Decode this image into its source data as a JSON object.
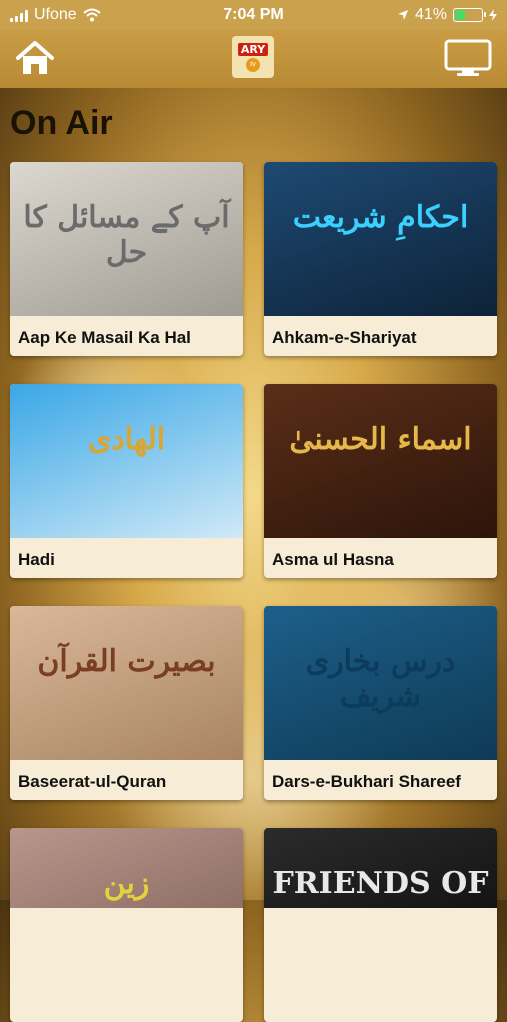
{
  "status_bar": {
    "carrier": "Ufone",
    "time": "7:04 PM",
    "battery_percent": "41%",
    "battery_level": 0.41,
    "icons": [
      "signal-icon",
      "wifi-icon",
      "location-arrow-icon",
      "battery-icon",
      "charging-icon"
    ]
  },
  "nav": {
    "home_icon": "home-icon",
    "logo_text": "ARY",
    "logo_sub": "tv",
    "tv_icon": "tv-monitor-icon"
  },
  "section_title": "On Air",
  "programs": [
    {
      "label": "Aap Ke Masail Ka Hal",
      "thumb_text": "آپ کے مسائل کا حل",
      "bg1": "#dcd8cf",
      "bg2": "#9f9b93",
      "text_color": "#6b6b6b"
    },
    {
      "label": "Ahkam-e-Shariyat",
      "thumb_text": "احکامِ شریعت",
      "bg1": "#1e4a73",
      "bg2": "#0d2238",
      "text_color": "#3ad0ff"
    },
    {
      "label": "Hadi",
      "thumb_text": "الهادی",
      "bg1": "#3aa7e6",
      "bg2": "#cfe9f7",
      "text_color": "#d9a62e"
    },
    {
      "label": "Asma ul Hasna",
      "thumb_text": "اسماء الحسنیٰ",
      "bg1": "#5a2e18",
      "bg2": "#2d140a",
      "text_color": "#e6b84a"
    },
    {
      "label": "Baseerat-ul-Quran",
      "thumb_text": "بصیرت القرآن",
      "bg1": "#d9b89a",
      "bg2": "#a88462",
      "text_color": "#7a3e22"
    },
    {
      "label": "Dars-e-Bukhari Shareef",
      "thumb_text": "درس بخاری شریف",
      "bg1": "#1d5f8a",
      "bg2": "#0e3a55",
      "text_color": "#0d3b5c"
    },
    {
      "label": "",
      "thumb_text": "زین",
      "bg1": "#b9968c",
      "bg2": "#8f6f66",
      "text_color": "#e6d23a"
    },
    {
      "label": "",
      "thumb_text": "FRIENDS OF",
      "bg1": "#2b2b2b",
      "bg2": "#141414",
      "text_color": "#e8e8e8"
    }
  ]
}
